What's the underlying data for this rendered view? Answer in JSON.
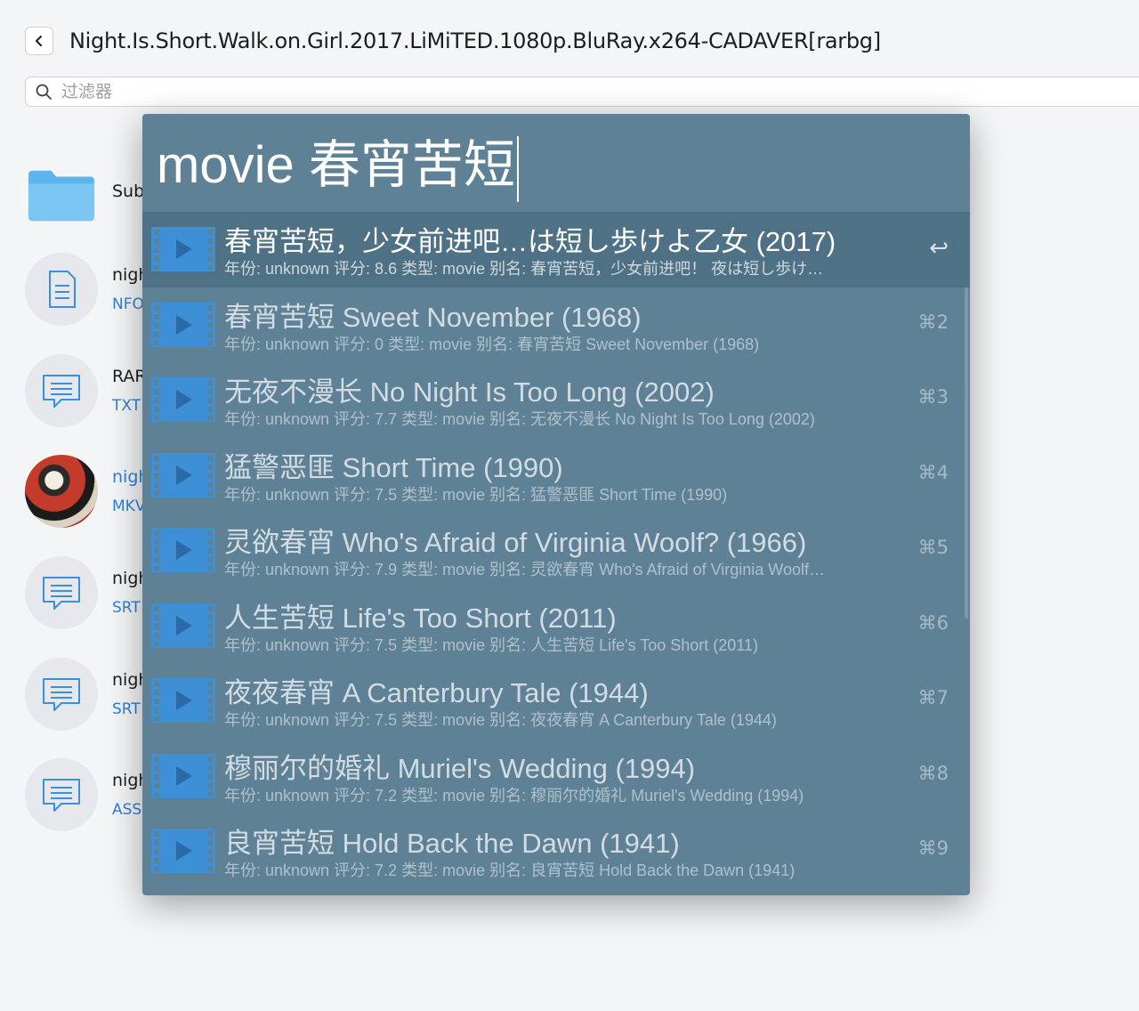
{
  "header": {
    "path_title": "Night.Is.Short.Walk.on.Girl.2017.LiMiTED.1080p.BluRay.x264-CADAVER[rarbg]"
  },
  "filter": {
    "placeholder": "过滤器",
    "value": ""
  },
  "files": [
    {
      "name": "Subs",
      "type": "",
      "icon": "folder-icon"
    },
    {
      "name": "nigh",
      "type": "NFO",
      "icon": "document-icon"
    },
    {
      "name": "RAR",
      "type": "TXT",
      "icon": "chat-icon"
    },
    {
      "name": "nigh",
      "type": "MKV",
      "icon": "video-thumbnail"
    },
    {
      "name": "nigh",
      "type": "SRT",
      "icon": "chat-icon"
    },
    {
      "name": "nigh",
      "type": "SRT",
      "icon": "chat-icon"
    },
    {
      "name": "nigh",
      "type": "ASS",
      "icon": "chat-icon"
    }
  ],
  "launcher": {
    "query": "movie 春宵苦短",
    "results": [
      {
        "title": "春宵苦短，少女前进吧…は短し歩けよ乙女 (2017)",
        "subtitle": "年份: unknown 评分: 8.6 类型: movie 别名: 春宵苦短，少女前进吧！ 夜は短し歩け…",
        "shortcut": "↩"
      },
      {
        "title": "春宵苦短 Sweet November (1968)",
        "subtitle": "年份: unknown 评分: 0 类型: movie 别名: 春宵苦短 Sweet November (1968)",
        "shortcut": "⌘2"
      },
      {
        "title": "无夜不漫长 No Night Is Too Long (2002)",
        "subtitle": "年份: unknown 评分: 7.7 类型: movie 别名: 无夜不漫长 No Night Is Too Long (2002)",
        "shortcut": "⌘3"
      },
      {
        "title": "猛警恶匪 Short Time (1990)",
        "subtitle": "年份: unknown 评分: 7.5 类型: movie 别名: 猛警恶匪 Short Time (1990)",
        "shortcut": "⌘4"
      },
      {
        "title": "灵欲春宵 Who's Afraid of Virginia Woolf? (1966)",
        "subtitle": "年份: unknown 评分: 7.9 类型: movie 别名: 灵欲春宵 Who's Afraid of Virginia Woolf…",
        "shortcut": "⌘5"
      },
      {
        "title": "人生苦短 Life's Too Short (2011)",
        "subtitle": "年份: unknown 评分: 7.5 类型: movie 别名: 人生苦短 Life's Too Short (2011)",
        "shortcut": "⌘6"
      },
      {
        "title": "夜夜春宵 A Canterbury Tale (1944)",
        "subtitle": "年份: unknown 评分: 7.5 类型: movie 别名: 夜夜春宵 A Canterbury Tale (1944)",
        "shortcut": "⌘7"
      },
      {
        "title": "穆丽尔的婚礼 Muriel's Wedding (1994)",
        "subtitle": "年份: unknown 评分: 7.2 类型: movie 别名: 穆丽尔的婚礼 Muriel's Wedding (1994)",
        "shortcut": "⌘8"
      },
      {
        "title": "良宵苦短 Hold Back the Dawn (1941)",
        "subtitle": "年份: unknown 评分: 7.2 类型: movie 别名: 良宵苦短 Hold Back the Dawn (1941)",
        "shortcut": "⌘9"
      }
    ]
  },
  "colors": {
    "launcher_bg": "#5e8196",
    "selected_row": "#4f7185",
    "play_icon": "#3d8fd6",
    "file_type_link": "#2f7fd6"
  }
}
